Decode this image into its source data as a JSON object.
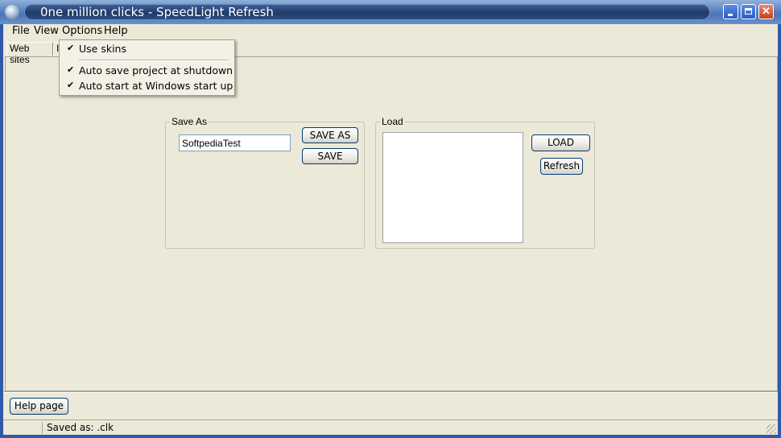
{
  "window": {
    "title": "0ne million clicks - SpeedLight Refresh",
    "controls": {
      "minimize": "minimize",
      "maximize": "maximize",
      "close": "✕"
    }
  },
  "menubar": [
    {
      "label": "File"
    },
    {
      "label": "View"
    },
    {
      "label": "Options"
    },
    {
      "label": "Help"
    }
  ],
  "tabs": [
    {
      "label": "Web sites"
    },
    {
      "label": "I"
    }
  ],
  "options_menu": {
    "items": [
      {
        "label": "Use skins",
        "checked": true
      },
      {
        "label": "Auto save project at shutdown",
        "checked": true
      },
      {
        "label": "Auto start at Windows start up",
        "checked": true
      }
    ],
    "check_glyph": "✔"
  },
  "save_group": {
    "legend": "Save As",
    "filename_value": "SoftpediaTest",
    "save_as_label": "SAVE AS",
    "save_label": "SAVE"
  },
  "load_group": {
    "legend": "Load",
    "items": [],
    "load_label": "LOAD",
    "refresh_label": "Refresh"
  },
  "footer": {
    "help_label": "Help page"
  },
  "statusbar": {
    "text": "Saved as: .clk"
  },
  "colors": {
    "titlebar": "#4a74b6",
    "face": "#ece9d8",
    "close": "#c8401e"
  }
}
